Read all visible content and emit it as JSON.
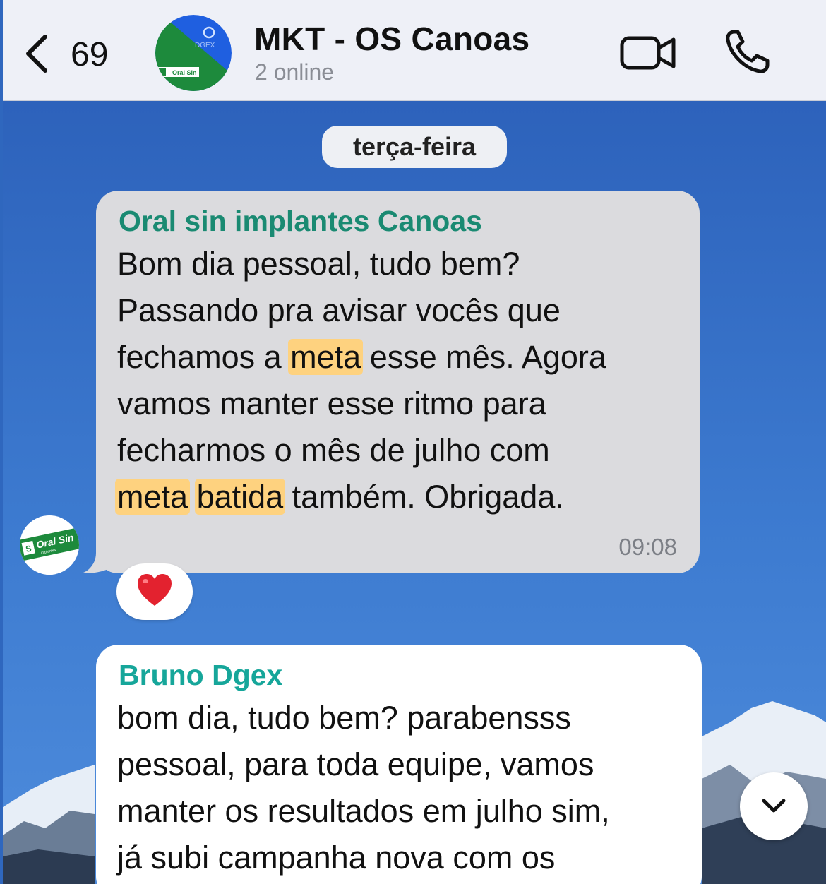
{
  "header": {
    "back_count": "69",
    "title": "MKT - OS Canoas",
    "subtitle": "2 online",
    "avatar_text_top": "DGEX",
    "avatar_text_bottom": "Oral Sin"
  },
  "chat": {
    "date_separator": "terça-feira",
    "messages": [
      {
        "sender": "Oral sin implantes Canoas",
        "sender_color": "#1a8a72",
        "bubble_color": "#dbdbde",
        "lines": [
          "Bom dia pessoal, tudo bem?",
          "Passando pra avisar vocês que",
          {
            "pre": "fechamos a ",
            "hl": "meta",
            "post": " esse mês. Agora"
          },
          "vamos manter esse ritmo para",
          "fecharmos o mês de julho com",
          {
            "hl1": "meta",
            "hl2": "batida",
            "post": " também. Obrigada."
          }
        ],
        "time": "09:08",
        "reaction": "heart-emoji",
        "avatar_text": "Oral Sin",
        "avatar_subtext": "implantes"
      },
      {
        "sender": "Bruno Dgex",
        "sender_color": "#16a69a",
        "bubble_color": "#ffffff",
        "lines": [
          "bom dia, tudo bem? parabensss",
          "pessoal, para toda equipe, vamos",
          "manter os resultados em julho sim,",
          "já subi campanha nova com os"
        ]
      }
    ]
  },
  "colors": {
    "highlight": "#fed27f",
    "header_bg": "#eef0f7",
    "brand_green": "#1d8a3c",
    "brand_blue": "#1f5fe0"
  },
  "icons": [
    "chevron-left-icon",
    "video-camera-icon",
    "phone-icon",
    "heart-icon",
    "chevron-down-icon"
  ]
}
